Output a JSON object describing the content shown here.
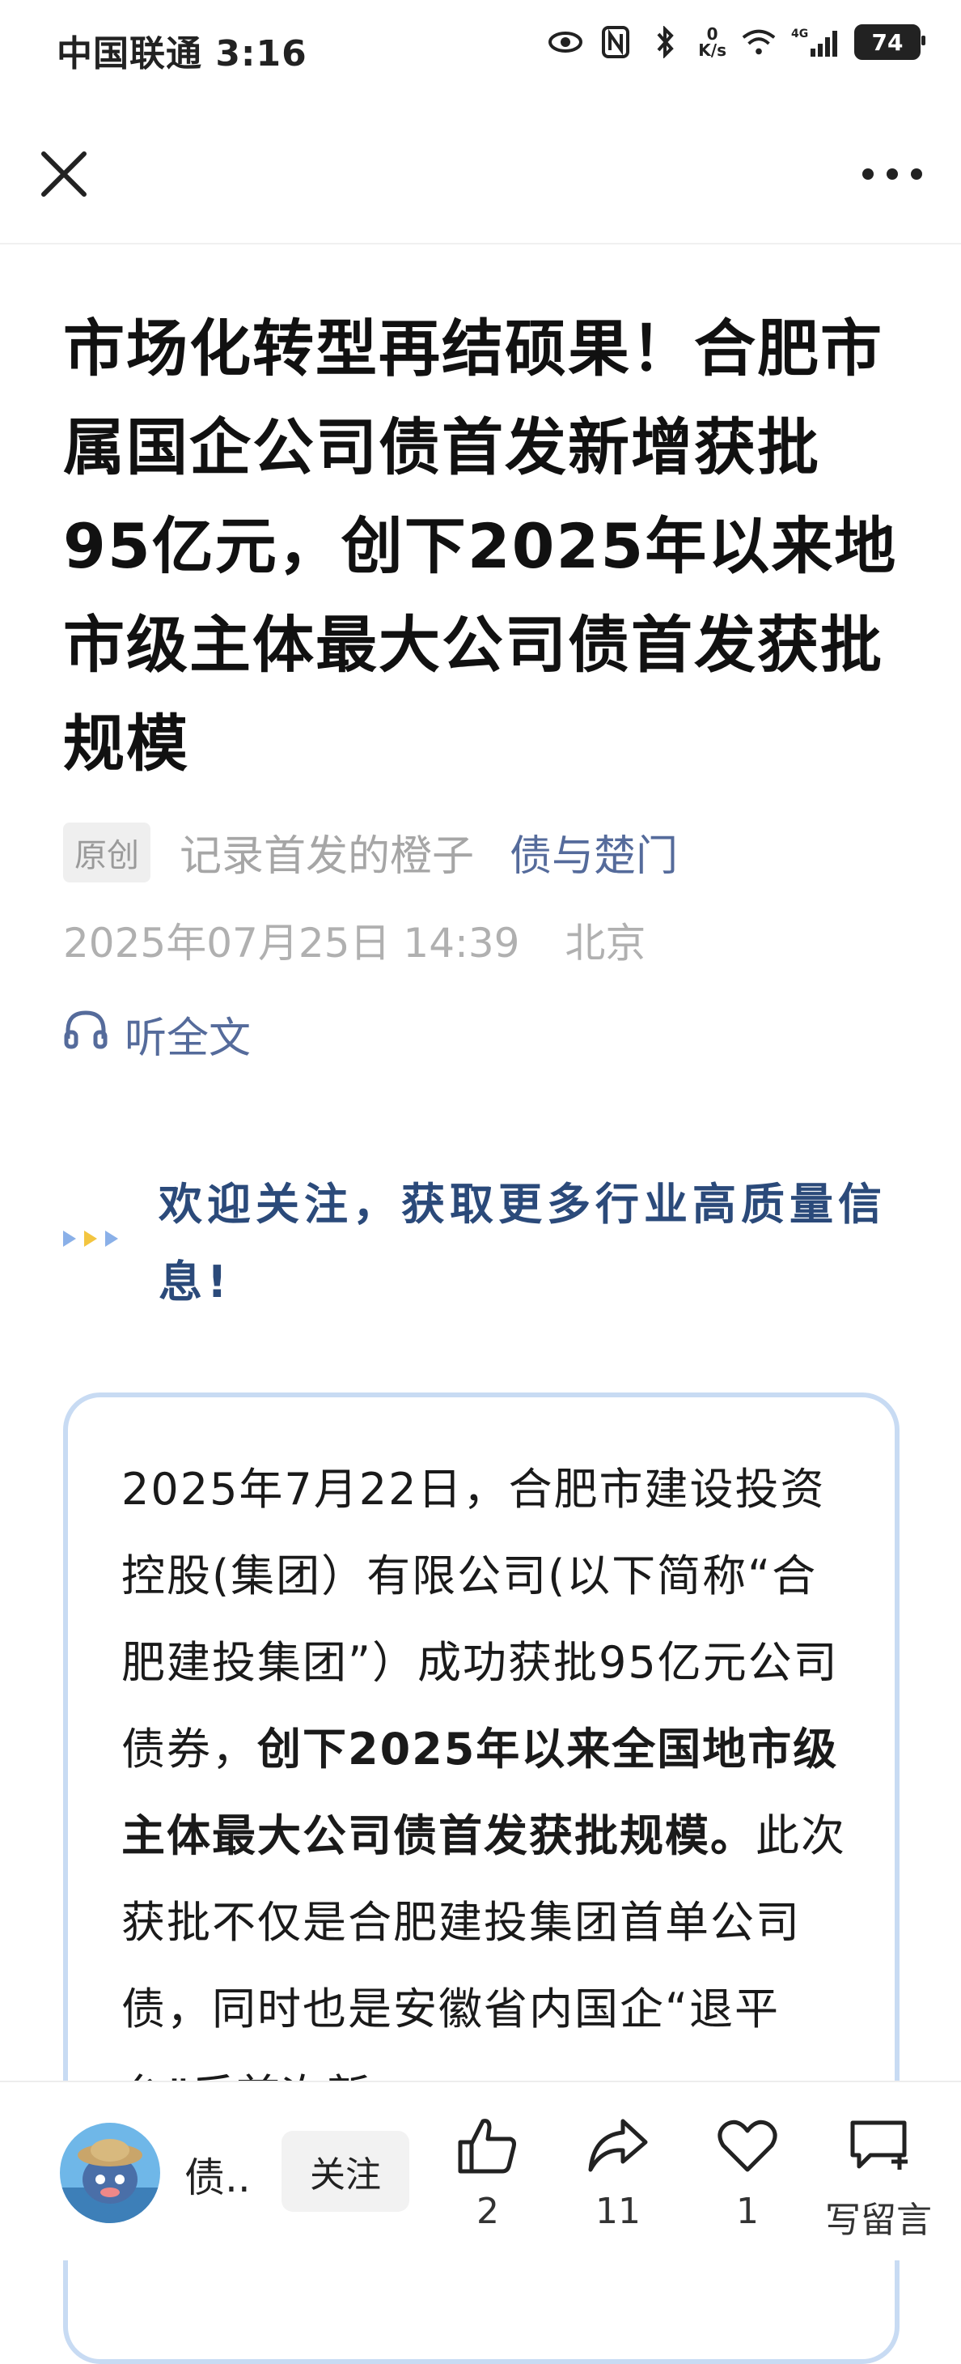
{
  "status_bar": {
    "carrier_time": "中国联通 3:16",
    "net_speed_value": "0",
    "net_speed_unit": "K/s",
    "signal_label": "4G",
    "battery": "74"
  },
  "nav": {
    "close_icon": "close-icon",
    "more_icon": "more-icon"
  },
  "article": {
    "title": "市场化转型再结硕果！合肥市属国企公司债首发新增获批95亿元，创下2025年以来地市级主体最大公司债首发获批规模",
    "original_badge": "原创",
    "author": "记录首发的橙子",
    "account": "债与楚门",
    "date": "2025年07月25日 14:39",
    "location": "北京",
    "listen_label": "听全文",
    "banner_text": "欢迎关注，获取更多行业高质量信息!",
    "body_normal_1": "2025年7月22日，合肥市建设投资控股(集团）有限公司(以下简称“合肥建投集团”）成功获批95亿元公司债券，",
    "body_bold": "创下2025年以来全国地市级主体最大公司债首发获批规模。",
    "body_normal_2": "此次获批不仅是合肥建投集团首单公司债，同时也是安徽省内国企“退平台”后首次新"
  },
  "bottom_bar": {
    "account_short": "债..",
    "follow_label": "关注",
    "like_count": "2",
    "share_count": "11",
    "favorite_count": "1",
    "comment_label": "写留言"
  },
  "colors": {
    "accent": "#556b9b",
    "banner_text": "#2b4a7a",
    "box_border": "#c8dbf3"
  }
}
